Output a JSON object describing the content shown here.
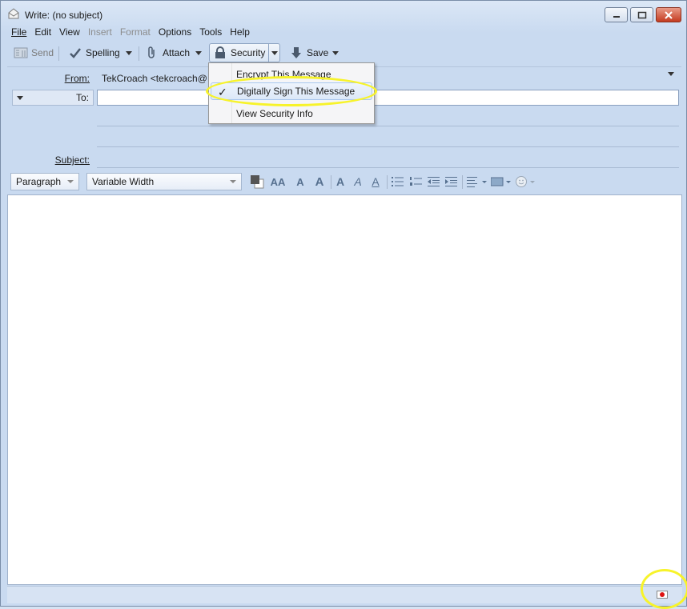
{
  "window": {
    "title": "Write: (no subject)"
  },
  "menu": [
    {
      "label": "File",
      "enabled": true
    },
    {
      "label": "Edit",
      "enabled": true
    },
    {
      "label": "View",
      "enabled": true
    },
    {
      "label": "Insert",
      "enabled": false
    },
    {
      "label": "Format",
      "enabled": false
    },
    {
      "label": "Options",
      "enabled": true
    },
    {
      "label": "Tools",
      "enabled": true
    },
    {
      "label": "Help",
      "enabled": true
    }
  ],
  "toolbar": {
    "send": "Send",
    "spelling": "Spelling",
    "attach": "Attach",
    "security": "Security",
    "save": "Save"
  },
  "header": {
    "from_label": "From:",
    "from_value": "TekCroach <tekcroach@",
    "to_label": "To:",
    "to_value": "",
    "subject_label": "Subject:",
    "subject_value": ""
  },
  "formatbar": {
    "paragraph": "Paragraph",
    "font": "Variable Width"
  },
  "security_menu": {
    "items": [
      {
        "label": "Encrypt This Message",
        "checked": false
      },
      {
        "label": "Digitally Sign This Message",
        "checked": true
      },
      {
        "label": "View Security Info",
        "checked": false
      }
    ]
  },
  "colors": {
    "highlight": "#f7f32a",
    "window_bg": "#c9daf0"
  }
}
